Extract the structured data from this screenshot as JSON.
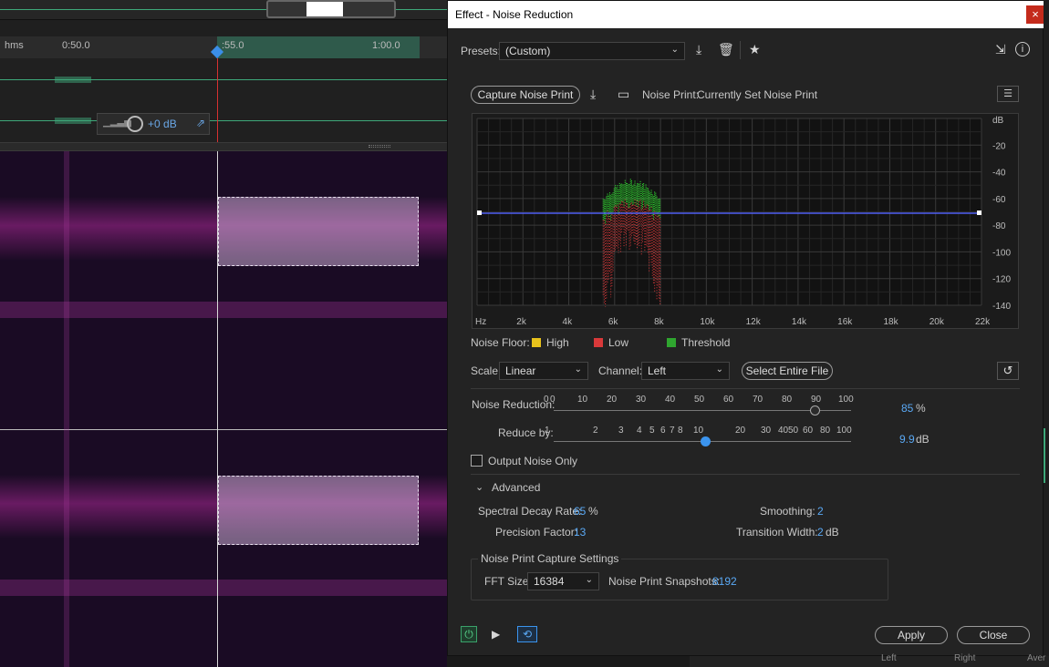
{
  "editor": {
    "ruler": {
      "unit": "hms",
      "labels": [
        "0:50.0",
        ":55.0",
        "1:00.0"
      ]
    },
    "hud": {
      "gain": "+0 dB"
    }
  },
  "dialog": {
    "title": "Effect - Noise Reduction",
    "close_glyph": "×",
    "presets": {
      "label": "Presets:",
      "value": "(Custom)"
    },
    "capture_button": "Capture Noise Print",
    "noise_print": {
      "label": "Noise Print:",
      "value": "Currently Set Noise Print"
    },
    "graph": {
      "y_unit": "dB",
      "y_ticks": [
        "-20",
        "-40",
        "-60",
        "-80",
        "-100",
        "-120",
        "-140"
      ],
      "x_ticks": [
        "Hz",
        "2k",
        "4k",
        "6k",
        "8k",
        "10k",
        "12k",
        "14k",
        "16k",
        "18k",
        "20k",
        "22k"
      ]
    },
    "legend": {
      "label": "Noise Floor:",
      "items": [
        {
          "name": "High",
          "color": "#e8c21c"
        },
        {
          "name": "Low",
          "color": "#d9393a"
        },
        {
          "name": "Threshold",
          "color": "#2fa52f"
        }
      ]
    },
    "scale": {
      "label": "Scale:",
      "value": "Linear"
    },
    "channel": {
      "label": "Channel:",
      "value": "Left"
    },
    "select_file_button": "Select Entire File",
    "noise_reduction": {
      "label": "Noise Reduction:",
      "ticks": [
        "0",
        "0",
        "10",
        "20",
        "30",
        "40",
        "50",
        "60",
        "70",
        "80",
        "90",
        "100"
      ],
      "value": "85",
      "unit": "%",
      "fraction": 0.85
    },
    "reduce_by": {
      "label": "Reduce by:",
      "ticks": [
        "1",
        "2",
        "3",
        "4",
        "5",
        "6",
        "7",
        "8",
        "10",
        "20",
        "30",
        "40",
        "50",
        "60",
        "80",
        "100"
      ],
      "value": "9.9",
      "unit": "dB"
    },
    "output_noise_only": {
      "label": "Output Noise Only",
      "checked": false
    },
    "advanced": {
      "label": "Advanced",
      "spectral_decay": {
        "label": "Spectral Decay Rate:",
        "value": "65",
        "unit": "%"
      },
      "smoothing": {
        "label": "Smoothing:",
        "value": "2"
      },
      "precision": {
        "label": "Precision Factor:",
        "value": "13"
      },
      "transition": {
        "label": "Transition Width:",
        "value": "2",
        "unit": "dB"
      }
    },
    "capture_settings": {
      "label": "Noise Print Capture Settings",
      "fft_label": "FFT Size:",
      "fft_value": "16384",
      "snapshots_label": "Noise Print Snapshots:",
      "snapshots_value": "8192"
    },
    "apply_button": "Apply",
    "close_button": "Close"
  },
  "bottom": {
    "labels": [
      "Left",
      "Right",
      "Aver"
    ]
  },
  "colors": {
    "accent": "#5aa9f5",
    "threshold_line": "#4f5ef2",
    "playhead": "#d73030"
  }
}
